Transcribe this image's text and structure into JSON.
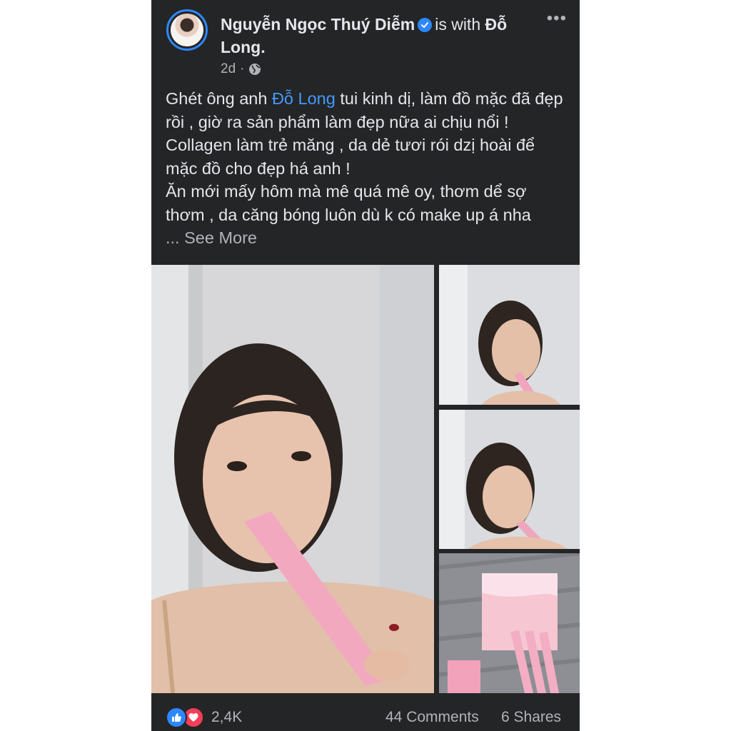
{
  "header": {
    "author_name": "Nguyễn Ngọc Thuý Diễm",
    "with_text": "is with",
    "tagged_name": "Đỗ Long.",
    "time": "2d",
    "separator": "·",
    "more_icon": "more-horizontal-icon"
  },
  "post": {
    "line1_before": "Ghét ông anh ",
    "mention": "Đỗ Long",
    "line1_after": " tui kinh dị, làm đồ mặc đã đẹp rồi , giờ ra sản phẩm làm đẹp nữa ai chịu nổi ! Collagen làm trẻ măng , da dẻ tươi rói dzị hoài để mặc đồ cho đẹp há anh !",
    "line2": "Ăn mới mấy hôm mà mê quá mê oy, thơm dể sợ thơm , da căng bóng luôn dù k có make up á nha",
    "see_more": "... See More"
  },
  "footer": {
    "reaction_count": "2,4K",
    "comments": "44 Comments",
    "shares": "6 Shares"
  },
  "colors": {
    "background": "#242526",
    "text": "#e4e6eb",
    "muted": "#b0b3b8",
    "link": "#4599ff",
    "like": "#2d88ff",
    "love": "#f33e58"
  }
}
